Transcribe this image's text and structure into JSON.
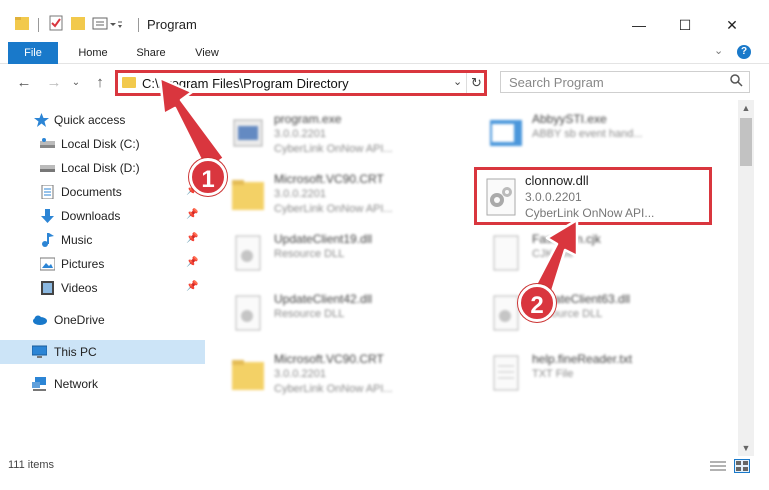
{
  "window": {
    "title": "Program",
    "minimize_icon": "minimize-icon",
    "maximize_icon": "maximize-icon",
    "close_icon": "close-icon"
  },
  "ribbon": {
    "tabs": [
      {
        "label": "File"
      },
      {
        "label": "Home"
      },
      {
        "label": "Share"
      },
      {
        "label": "View"
      }
    ],
    "help_icon": "?"
  },
  "nav": {
    "back": "←",
    "forward": "→",
    "recent": "⌄",
    "up": "↑",
    "address": "C:\\Program Files\\Program Directory",
    "refresh": "↻",
    "search_placeholder": "Search Program"
  },
  "sidebar": {
    "items": [
      {
        "label": "Quick access",
        "icon": "star-icon"
      },
      {
        "label": "Local Disk (C:)",
        "icon": "drive-icon"
      },
      {
        "label": "Local Disk (D:)",
        "icon": "drive-icon"
      },
      {
        "label": "Documents",
        "icon": "documents-icon"
      },
      {
        "label": "Downloads",
        "icon": "download-icon"
      },
      {
        "label": "Music",
        "icon": "music-icon"
      },
      {
        "label": "Pictures",
        "icon": "pictures-icon"
      },
      {
        "label": "Videos",
        "icon": "videos-icon"
      },
      {
        "label": "OneDrive",
        "icon": "cloud-icon"
      },
      {
        "label": "This PC",
        "icon": "computer-icon"
      },
      {
        "label": "Network",
        "icon": "network-icon"
      }
    ]
  },
  "files": [
    {
      "name": "program.exe",
      "line1": "3.0.0.2201",
      "line2": "CyberLink OnNow API..."
    },
    {
      "name": "AbbyySTI.exe",
      "line1": "ABBY sb event hand...",
      "line2": ""
    },
    {
      "name": "Microsoft.VC90.CRT",
      "line1": "3.0.0.2201",
      "line2": "CyberLink OnNow API..."
    },
    {
      "name": "UpdateClient19.dll",
      "line1": "Resource DLL",
      "line2": ""
    },
    {
      "name": "FastScan.cjk",
      "line1": "CJK File",
      "line2": ""
    },
    {
      "name": "UpdateClient42.dll",
      "line1": "Resource DLL",
      "line2": ""
    },
    {
      "name": "UpdateClient63.dll",
      "line1": "Resource DLL",
      "line2": ""
    },
    {
      "name": "Microsoft.VC90.CRT",
      "line1": "3.0.0.2201",
      "line2": "CyberLink OnNow API..."
    },
    {
      "name": "help.fineReader.txt",
      "line1": "TXT File",
      "line2": ""
    }
  ],
  "highlighted_file": {
    "name": "clonnow.dll",
    "version": "3.0.0.2201",
    "description": "CyberLink OnNow API..."
  },
  "status": {
    "count": "111 items"
  },
  "callouts": [
    "1",
    "2"
  ],
  "colors": {
    "accent": "#1979ca",
    "highlight": "#d9363e",
    "selection": "#cce4f7"
  }
}
